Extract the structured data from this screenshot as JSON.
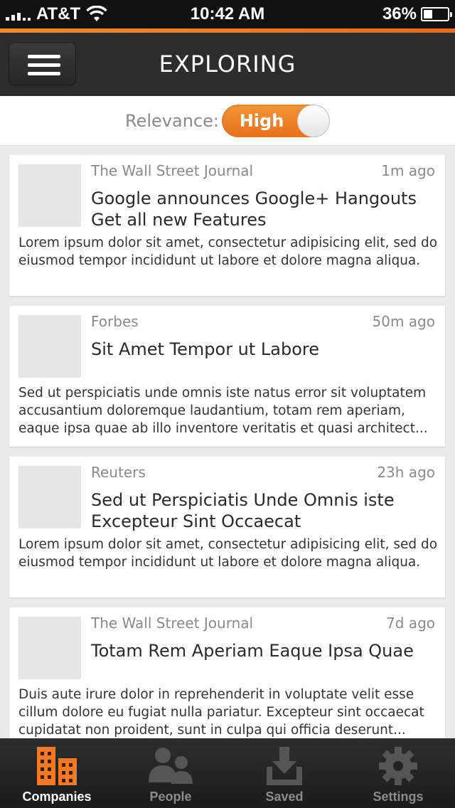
{
  "status_bar": {
    "carrier": "AT&T",
    "time": "10:42 AM",
    "battery": "36%"
  },
  "nav": {
    "title": "EXPLORING"
  },
  "relevance": {
    "label": "Relevance:",
    "value": "High"
  },
  "articles": [
    {
      "source": "The Wall Street Journal",
      "time": "1m ago",
      "headline": "Google announces Google+ Hangouts Get all new Features",
      "snippet": "Lorem ipsum dolor sit amet, consectetur adipisicing elit, sed do eiusmod tempor incididunt ut labore et dolore magna aliqua."
    },
    {
      "source": "Forbes",
      "time": "50m ago",
      "headline": "Sit Amet Tempor ut Labore",
      "snippet": "Sed ut perspiciatis unde omnis iste natus error sit voluptatem accusantium doloremque laudantium, totam rem aperiam, eaque ipsa quae ab illo inventore veritatis et quasi architect..."
    },
    {
      "source": "Reuters",
      "time": "23h ago",
      "headline": "Sed ut Perspiciatis Unde Omnis iste Excepteur Sint Occaecat",
      "snippet": "Lorem ipsum dolor sit amet, consectetur adipisicing elit, sed do eiusmod tempor incididunt ut labore et dolore magna aliqua."
    },
    {
      "source": "The Wall Street Journal",
      "time": "7d ago",
      "headline": "Totam Rem Aperiam Eaque Ipsa Quae",
      "snippet": "Duis aute irure dolor in reprehenderit in voluptate velit esse cillum dolore eu fugiat nulla pariatur. Excepteur sint occaecat cupidatat non proident, sunt in culpa qui officia deserunt..."
    }
  ],
  "tabs": [
    {
      "label": "Companies",
      "icon": "buildings-icon",
      "active": true
    },
    {
      "label": "People",
      "icon": "people-icon",
      "active": false
    },
    {
      "label": "Saved",
      "icon": "download-tray-icon",
      "active": false
    },
    {
      "label": "Settings",
      "icon": "gear-icon",
      "active": false
    }
  ],
  "colors": {
    "accent": "#e8711f",
    "active_tab_icon": "#f07a2a",
    "inactive_tab_icon": "#555555"
  }
}
